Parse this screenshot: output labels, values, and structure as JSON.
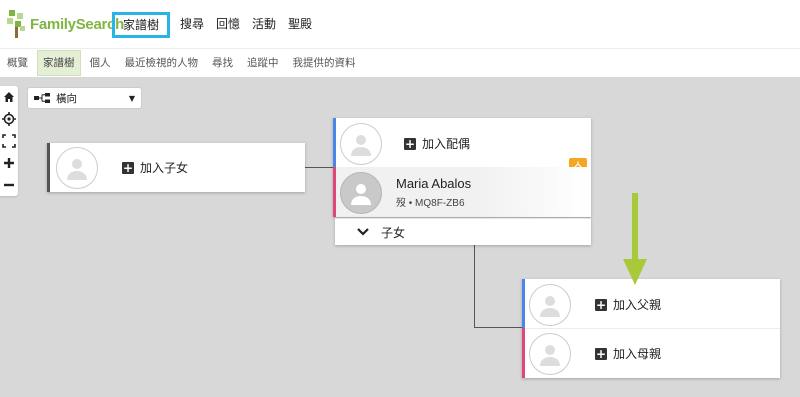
{
  "brand": {
    "logo_text": "FamilySearch",
    "accent": "#7fb541",
    "highlight": "#28b5e6"
  },
  "nav": {
    "items": [
      {
        "label": "家譜樹",
        "active": true
      },
      {
        "label": "搜尋"
      },
      {
        "label": "回憶"
      },
      {
        "label": "活動"
      },
      {
        "label": "聖殿"
      }
    ]
  },
  "subnav": {
    "items": [
      {
        "label": "概覽"
      },
      {
        "label": "家譜樹",
        "active": true
      },
      {
        "label": "個人"
      },
      {
        "label": "最近檢視的人物"
      },
      {
        "label": "尋找"
      },
      {
        "label": "追蹤中"
      },
      {
        "label": "我提供的資料"
      }
    ]
  },
  "toolbar": {
    "tools": [
      "home-icon",
      "locate-icon",
      "fullscreen-icon",
      "zoom-in-icon",
      "zoom-out-icon"
    ]
  },
  "layout_select": {
    "value": "橫向"
  },
  "tree": {
    "child_card": {
      "add_label": "加入子女"
    },
    "couple_card": {
      "add_spouse_label": "加入配偶",
      "person": {
        "name": "Maria Abalos",
        "details": "歿 • MQ8F-ZB6"
      },
      "children_label": "子女",
      "temple_color": "#f5a623"
    },
    "parents_card": {
      "add_father_label": "加入父親",
      "add_mother_label": "加入母親"
    },
    "colors": {
      "male": "#4a86e8",
      "female": "#e0457b",
      "unknown": "#555555"
    }
  }
}
